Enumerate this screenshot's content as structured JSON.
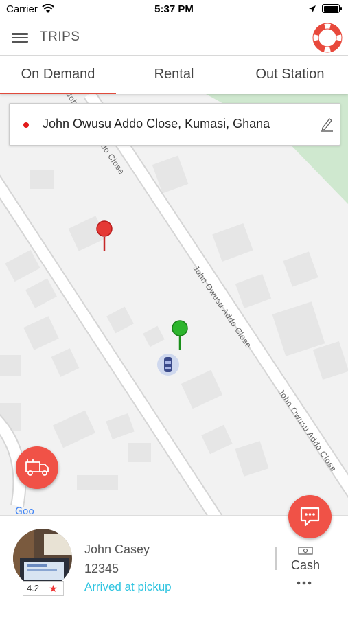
{
  "status_bar": {
    "carrier": "Carrier",
    "time": "5:37 PM"
  },
  "header": {
    "title": "TRIPS"
  },
  "tabs": [
    {
      "label": "On Demand",
      "active": true
    },
    {
      "label": "Rental",
      "active": false
    },
    {
      "label": "Out Station",
      "active": false
    }
  ],
  "search": {
    "address": "John Owusu Addo Close, Kumasi, Ghana"
  },
  "map": {
    "street_labels": [
      "John Owusu Addo Close",
      "John Owusu Addo Close",
      "John Owusu Addo Close"
    ],
    "pickup_pin_color": "#e53935",
    "dropoff_pin_color": "#2db52d"
  },
  "driver": {
    "name": "John Casey",
    "id": "12345",
    "status": "Arrived at pickup",
    "rating": "4.2"
  },
  "payment": {
    "label": "Cash"
  },
  "colors": {
    "accent": "#f05247",
    "status": "#2ec4e0"
  }
}
